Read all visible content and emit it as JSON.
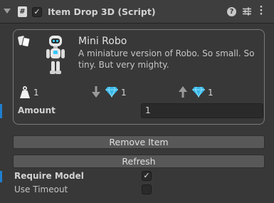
{
  "component": {
    "title": "Item Drop 3D (Script)",
    "script_icon_glyph": "#",
    "enabled_mark": "✓"
  },
  "item": {
    "name": "Mini Robo",
    "description": "A miniature version of Robo. So small. So tiny. But very mighty.",
    "weight": "1",
    "drop_gems": "1",
    "pickup_gems": "1"
  },
  "fields": {
    "amount_label": "Amount",
    "amount_value": "1",
    "require_model_label": "Require Model",
    "require_model_mark": "✓",
    "use_timeout_label": "Use Timeout"
  },
  "buttons": {
    "remove_item": "Remove Item",
    "refresh": "Refresh"
  },
  "icons": [
    "foldout-arrow-icon",
    "script-icon",
    "help-icon",
    "preset-icon",
    "context-menu-icon",
    "cards-icon",
    "robot-preview-icon",
    "weight-icon",
    "arrow-down-icon",
    "gem-icon",
    "arrow-up-icon"
  ],
  "colors": {
    "background": "#383838",
    "modified_indicator": "#1f7fd0",
    "gem": "#39b7e8"
  }
}
